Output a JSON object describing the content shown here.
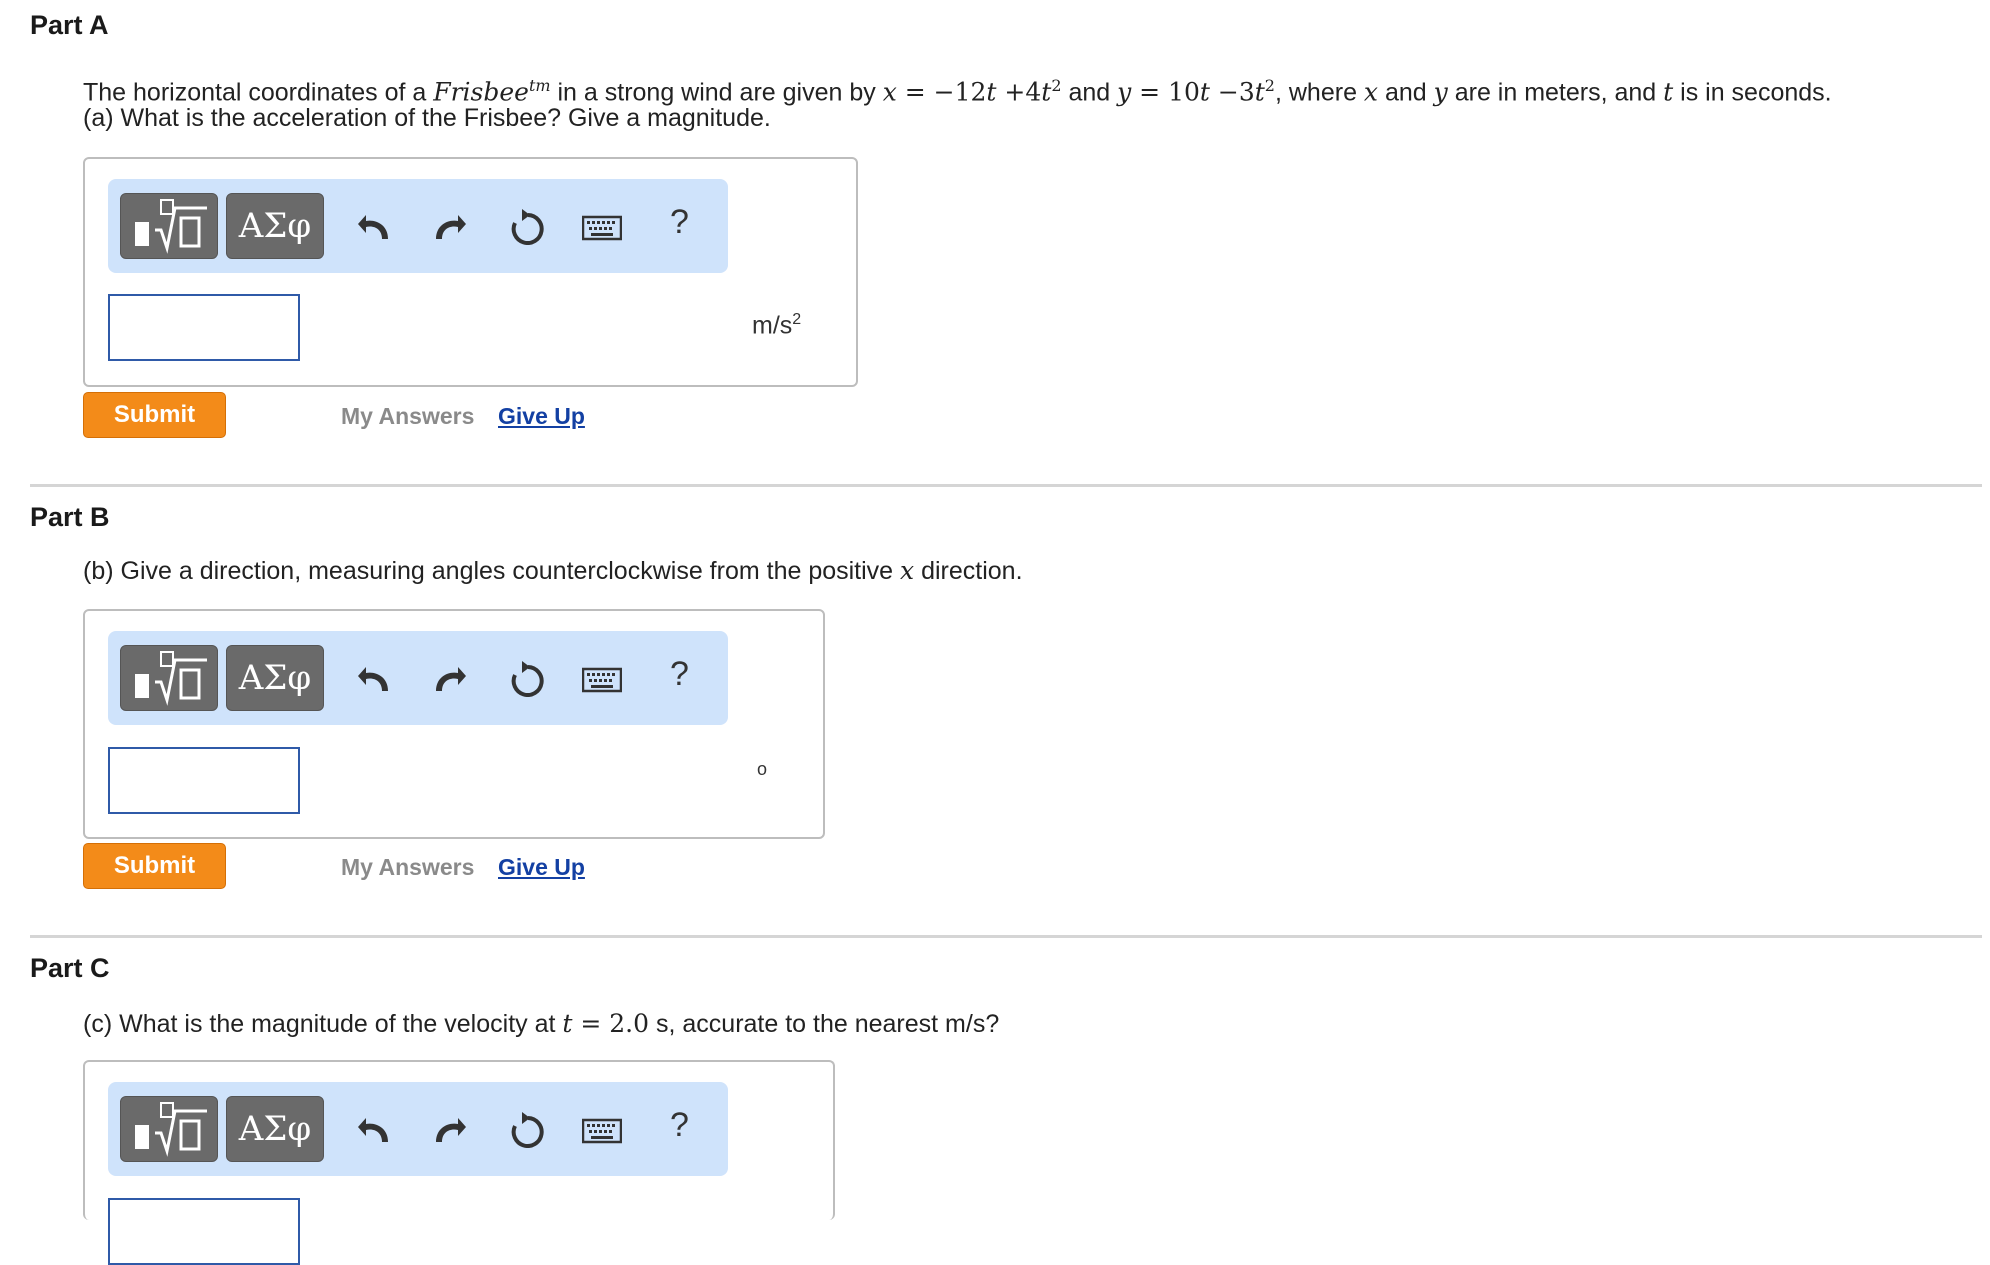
{
  "partA": {
    "title": "Part A",
    "q_pre": "The horizontal coordinates of a ",
    "q_frisbee": "Frisbee",
    "q_tm": "tm",
    "q_mid1": " in a strong wind are given by ",
    "q_x": "x",
    "q_eq1": " = −12",
    "q_t1": "t",
    "q_plus": " +4",
    "q_t2": "t",
    "q_sq1": "2",
    "q_and": " and ",
    "q_y": "y",
    "q_eq2": " = 10",
    "q_t3": "t",
    "q_minus": " −3",
    "q_t4": "t",
    "q_sq2": "2",
    "q_where": ", where ",
    "q_x2": "x",
    "q_and2": " and ",
    "q_y2": "y",
    "q_rest1": " are in meters, and ",
    "q_t5": "t",
    "q_rest2": " is in seconds.",
    "q_line2": "(a) What is the acceleration of the Frisbee? Give a magnitude.",
    "unit": "m/s",
    "unit_sup": "2",
    "submit": "Submit",
    "my_answers": "My Answers",
    "give_up": "Give Up"
  },
  "partB": {
    "title": "Part B",
    "q_pre": "(b) Give a direction, measuring angles counterclockwise from the positive ",
    "q_x": "x",
    "q_post": " direction.",
    "unit": "o",
    "submit": "Submit",
    "my_answers": "My Answers",
    "give_up": "Give Up"
  },
  "partC": {
    "title": "Part C",
    "q_pre": "(c) What is the magnitude of the velocity at ",
    "q_t": "t",
    "q_val": " = 2.0",
    "q_post": " s, accurate to the nearest m/s?"
  },
  "toolbar": {
    "greek_label": "ΑΣφ",
    "help_label": "?",
    "icons": [
      "templates-icon",
      "undo-icon",
      "redo-icon",
      "reset-icon",
      "keyboard-icon",
      "help-icon"
    ]
  },
  "colors": {
    "toolbar_bg": "#cfe3fb",
    "submit_bg": "#f38b19",
    "link": "#1340a3",
    "input_border": "#2f5aa8"
  }
}
